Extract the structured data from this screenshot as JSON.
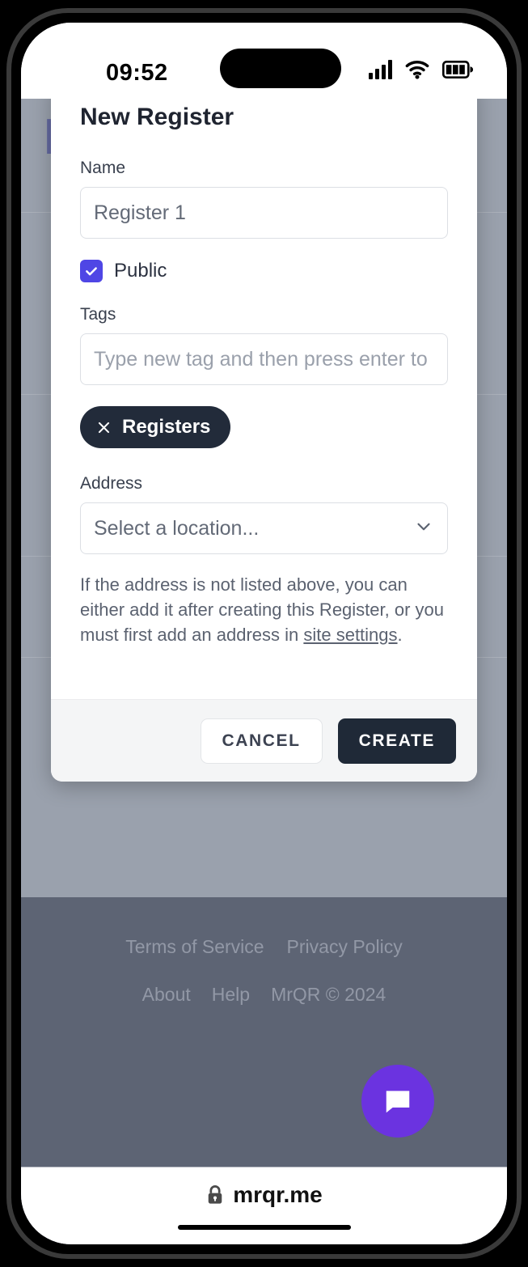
{
  "status_bar": {
    "time": "09:52",
    "icons": [
      "cellular-signal-icon",
      "wifi-icon",
      "battery-icon"
    ]
  },
  "background_page": {
    "brand": "MrQR",
    "footer": {
      "row1": [
        {
          "label": "Terms of Service"
        },
        {
          "label": "Privacy Policy"
        }
      ],
      "row2": [
        {
          "label": "About"
        },
        {
          "label": "Help"
        },
        {
          "label": "MrQR © 2024"
        }
      ]
    },
    "chat_button_icon": "chat-bubble-icon"
  },
  "modal": {
    "title": "New Register",
    "name_field": {
      "label": "Name",
      "value": "Register 1",
      "placeholder": "Register 1"
    },
    "public_checkbox": {
      "label": "Public",
      "checked": true
    },
    "tags_field": {
      "label": "Tags",
      "value": "",
      "placeholder": "Type new tag and then press enter to"
    },
    "tag_chips": [
      {
        "label": "Registers",
        "remove_icon": "close-icon"
      }
    ],
    "address_field": {
      "label": "Address",
      "value": "Select a location...",
      "chevron_icon": "chevron-down-icon"
    },
    "help_text": {
      "before": "If the address is not listed above, you can either add it after creating this Register, or you must first add an address in ",
      "link": "site settings",
      "after": "."
    },
    "footer": {
      "cancel_label": "CANCEL",
      "create_label": "CREATE"
    }
  },
  "browser": {
    "url": "mrqr.me",
    "lock_icon": "lock-icon"
  },
  "colors": {
    "accent_indigo": "#4f46e5",
    "chip_dark": "#222b3a",
    "create_dark": "#1f2937",
    "chat_purple": "#6b33e0",
    "overlay_gray": "#9aa1ad",
    "footer_gray": "#5d6474"
  }
}
